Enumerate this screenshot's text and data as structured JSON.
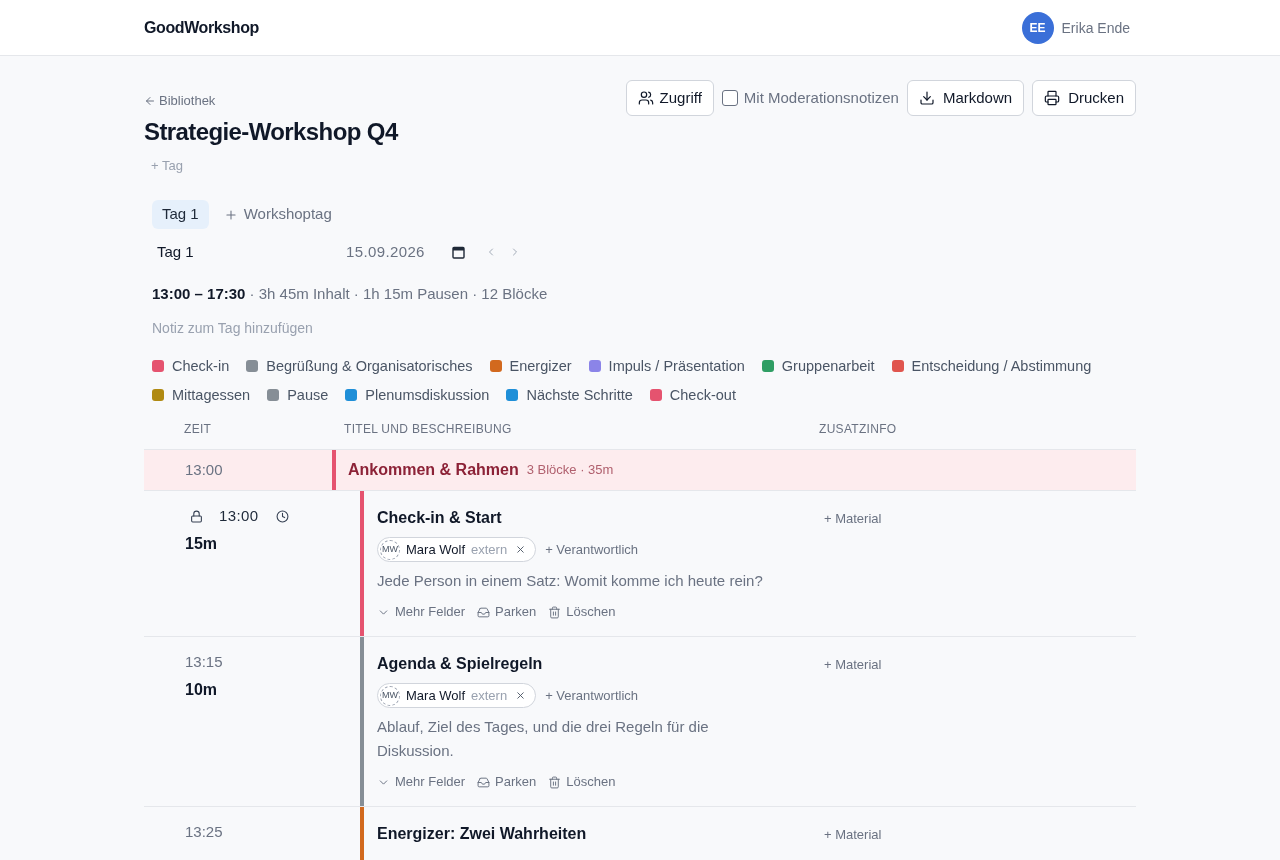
{
  "app": {
    "brand": "GoodWorkshop",
    "user": {
      "initials": "EE",
      "name": "Erika Ende"
    }
  },
  "back_link": "Bibliothek",
  "title": "Strategie-Workshop Q4",
  "add_tag": "+ Tag",
  "toolbar": {
    "access_button": "Zugriff",
    "notes_toggle": {
      "label": "Mit Moderationsnotizen",
      "checked": false
    },
    "export_button": "Markdown",
    "print_button": "Drucken"
  },
  "day_tabs": [
    {
      "label": "Tag 1",
      "selected": true
    }
  ],
  "add_day": "Workshoptag",
  "day": {
    "name": "Tag 1",
    "date": "15.09.2026",
    "summary": "**13:00 – 17:30** · 3h 45m Inhalt · 1h 15m Pausen · 12 Blöcke",
    "note_placeholder": "Notiz zum Tag hinzufügen"
  },
  "legend_rows": [
    [
      {
        "label": "Check-in",
        "color": "#e5536f"
      },
      {
        "label": "Begrüßung & Organisatorisches",
        "color": "#868e96"
      },
      {
        "label": "Energizer",
        "color": "#d2691e"
      },
      {
        "label": "Impuls / Präsentation",
        "color": "#8b84e8"
      },
      {
        "label": "Gruppenarbeit",
        "color": "#2f9e64"
      },
      {
        "label": "Entscheidung / Abstimmung",
        "color": "#e0554e"
      }
    ],
    [
      {
        "label": "Mittagessen",
        "color": "#b08a12"
      },
      {
        "label": "Pause",
        "color": "#868e96"
      },
      {
        "label": "Plenumsdiskussion",
        "color": "#1f8fd8"
      },
      {
        "label": "Nächste Schritte",
        "color": "#1f8fd8"
      },
      {
        "label": "Check-out",
        "color": "#e5536f"
      }
    ]
  ],
  "table": {
    "columns": [
      "ZEIT",
      "TITEL UND BESCHREIBUNG",
      "ZUSATZINFO"
    ],
    "groups": [
      {
        "start": "13:00",
        "title": "Ankommen & Rahmen",
        "meta": "3 Blöcke · 35m",
        "color": "#e5536f",
        "blocks": [
          {
            "start": "13:00",
            "locked": true,
            "duration": "15m",
            "color": "#e5536f",
            "title": "Check-in & Start",
            "people": [
              {
                "initials": "MW",
                "name": "Mara Wolf",
                "role": "extern"
              }
            ],
            "add_person": "+ Verantwortlich",
            "description": "Jede Person in einem Satz: Womit komme ich heute rein?",
            "actions": [
              {
                "kind": "expand",
                "label": "Mehr Felder"
              },
              {
                "kind": "park",
                "label": "Parken"
              },
              {
                "kind": "delete",
                "label": "Löschen"
              }
            ],
            "add_material": "+ Material"
          },
          {
            "start": "13:15",
            "locked": false,
            "duration": "10m",
            "color": "#868e96",
            "title": "Agenda & Spielregeln",
            "people": [
              {
                "initials": "MW",
                "name": "Mara Wolf",
                "role": "extern"
              }
            ],
            "add_person": "+ Verantwortlich",
            "description": "Ablauf, Ziel des Tages, und die drei Regeln für die Diskussion.",
            "actions": [
              {
                "kind": "expand",
                "label": "Mehr Felder"
              },
              {
                "kind": "park",
                "label": "Parken"
              },
              {
                "kind": "delete",
                "label": "Löschen"
              }
            ],
            "add_material": "+ Material"
          },
          {
            "start": "13:25",
            "locked": false,
            "color": "#d2691e",
            "title": "Energizer: Zwei Wahrheiten",
            "add_material": "+ Material"
          }
        ]
      }
    ]
  }
}
